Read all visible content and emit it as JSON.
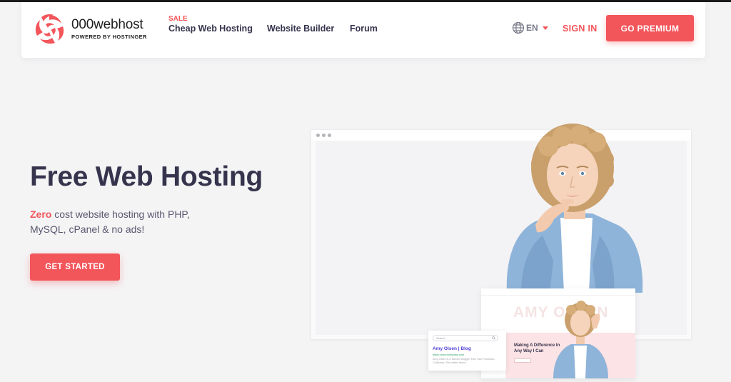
{
  "header": {
    "logo": {
      "name": "000webhost",
      "sub": "POWERED BY HOSTINGER"
    },
    "nav": {
      "sale_badge": "SALE",
      "hosting": "Cheap Web Hosting",
      "builder": "Website Builder",
      "forum": "Forum"
    },
    "language": {
      "label": "EN",
      "icon": "globe-icon"
    },
    "signin_label": "SIGN IN",
    "premium_label": "GO PREMIUM"
  },
  "hero": {
    "title": "Free Web Hosting",
    "subtitle_highlight": "Zero",
    "subtitle_rest": " cost website hosting with PHP, MySQL, cPanel & no ads!",
    "cta_label": "GET STARTED"
  },
  "illustration": {
    "blog_watermark": "AMY OLSEN",
    "blog_headline": "Making A Difference In Any Way I Can",
    "search": {
      "placeholder": "Search",
      "result_title": "Amy Olsen | Blog",
      "result_url": "https://yourcompany.com",
      "result_desc": "Amy Olsen is a fashion blogger from San Francisco, California. She writes about..."
    }
  },
  "colors": {
    "accent": "#f2555a",
    "text_dark": "#36344d",
    "background": "#f4f4f5"
  }
}
